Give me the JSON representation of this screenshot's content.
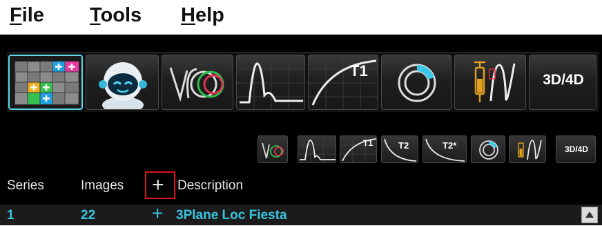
{
  "menu": {
    "file": {
      "label_rest": "ile",
      "mnemonic": "F"
    },
    "tools": {
      "label_rest": "ools",
      "mnemonic": "T"
    },
    "help": {
      "label_rest": "elp",
      "mnemonic": "H"
    }
  },
  "toolbar_main": {
    "buttons": [
      {
        "name": "image-grid-viewer",
        "active": true
      },
      {
        "name": "ai-assistant"
      },
      {
        "name": "function-analysis"
      },
      {
        "name": "flow-analysis"
      },
      {
        "name": "t1-mapping",
        "label": "T1"
      },
      {
        "name": "myocardial-evaluation"
      },
      {
        "name": "perfusion-analysis"
      },
      {
        "name": "3d-4d-viewer",
        "label": "3D/4D"
      }
    ]
  },
  "toolbar_secondary": {
    "t1": "T1",
    "t2": "T2",
    "t2star": "T2*",
    "viewer3d": "3D/4D"
  },
  "series_table": {
    "columns": {
      "series": "Series",
      "images": "Images",
      "add": "+",
      "description": "Description"
    },
    "rows": [
      {
        "series": "1",
        "images": "22",
        "add": "+",
        "description": "3Plane Loc Fiesta"
      }
    ]
  },
  "colors": {
    "accent_cyan": "#39c6e0",
    "highlight_red": "#e0141c",
    "background": "#000000"
  }
}
